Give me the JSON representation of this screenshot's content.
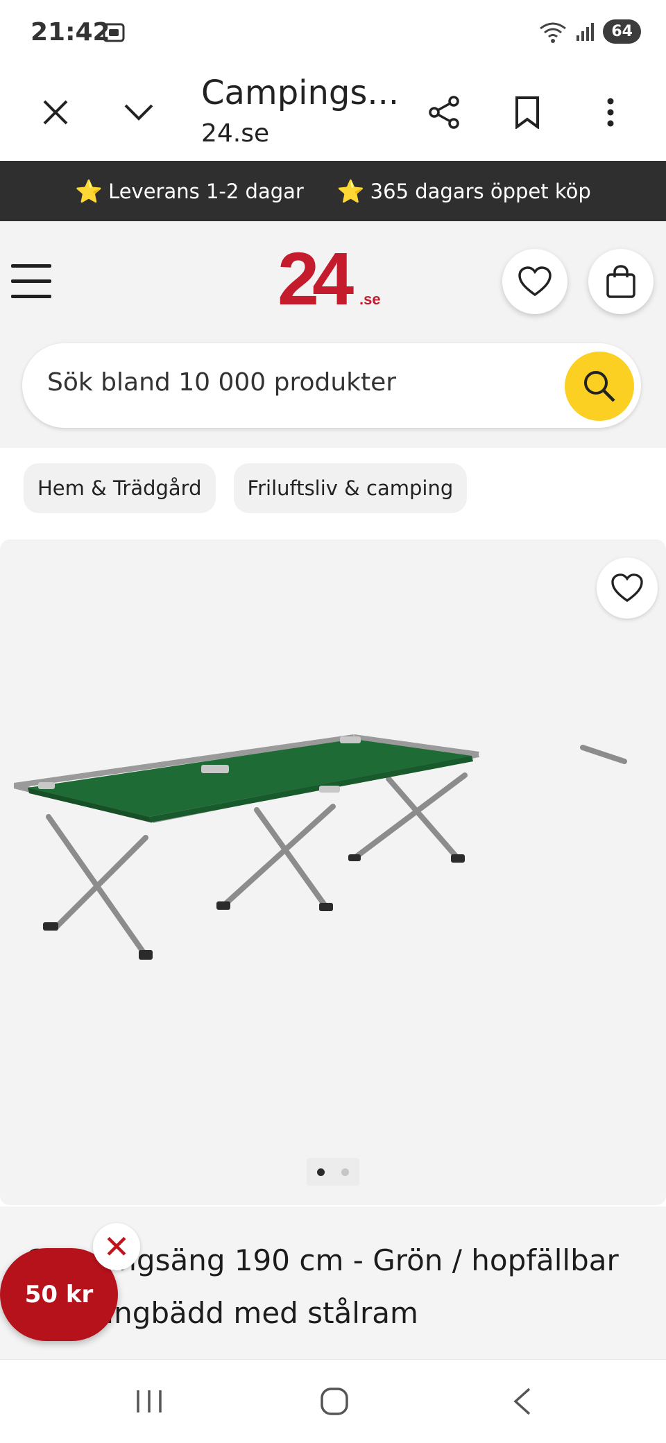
{
  "status_bar": {
    "time": "21:42",
    "battery": "64",
    "icons": [
      "screen-capture-icon",
      "wifi-icon",
      "signal-icon",
      "battery-icon"
    ]
  },
  "browser": {
    "title": "Campings...",
    "url": "24.se",
    "icons": [
      "close-icon",
      "chevron-down-icon",
      "share-icon",
      "bookmark-icon",
      "more-vert-icon"
    ]
  },
  "promo": {
    "items": [
      "Leverans 1-2 dagar",
      "365 dagars öppet köp"
    ],
    "star": "⭐"
  },
  "site_header": {
    "logo_number": "24",
    "logo_domain": ".se",
    "brand_color": "#c41c2c",
    "search_placeholder": "Sök bland 10 000 produkter",
    "search_button_color": "#fcd022"
  },
  "breadcrumbs": [
    "Hem & Trädgård",
    "Friluftsliv & camping"
  ],
  "gallery": {
    "image_count": 2,
    "active_index": 0
  },
  "product": {
    "title": "Campingsäng 190 cm - Grön / hopfällbar campingbädd med stålram"
  },
  "coupon": {
    "label": "50 kr",
    "close": "✕"
  },
  "navbar": {
    "icons": [
      "recent-apps-icon",
      "home-icon",
      "back-icon"
    ]
  }
}
